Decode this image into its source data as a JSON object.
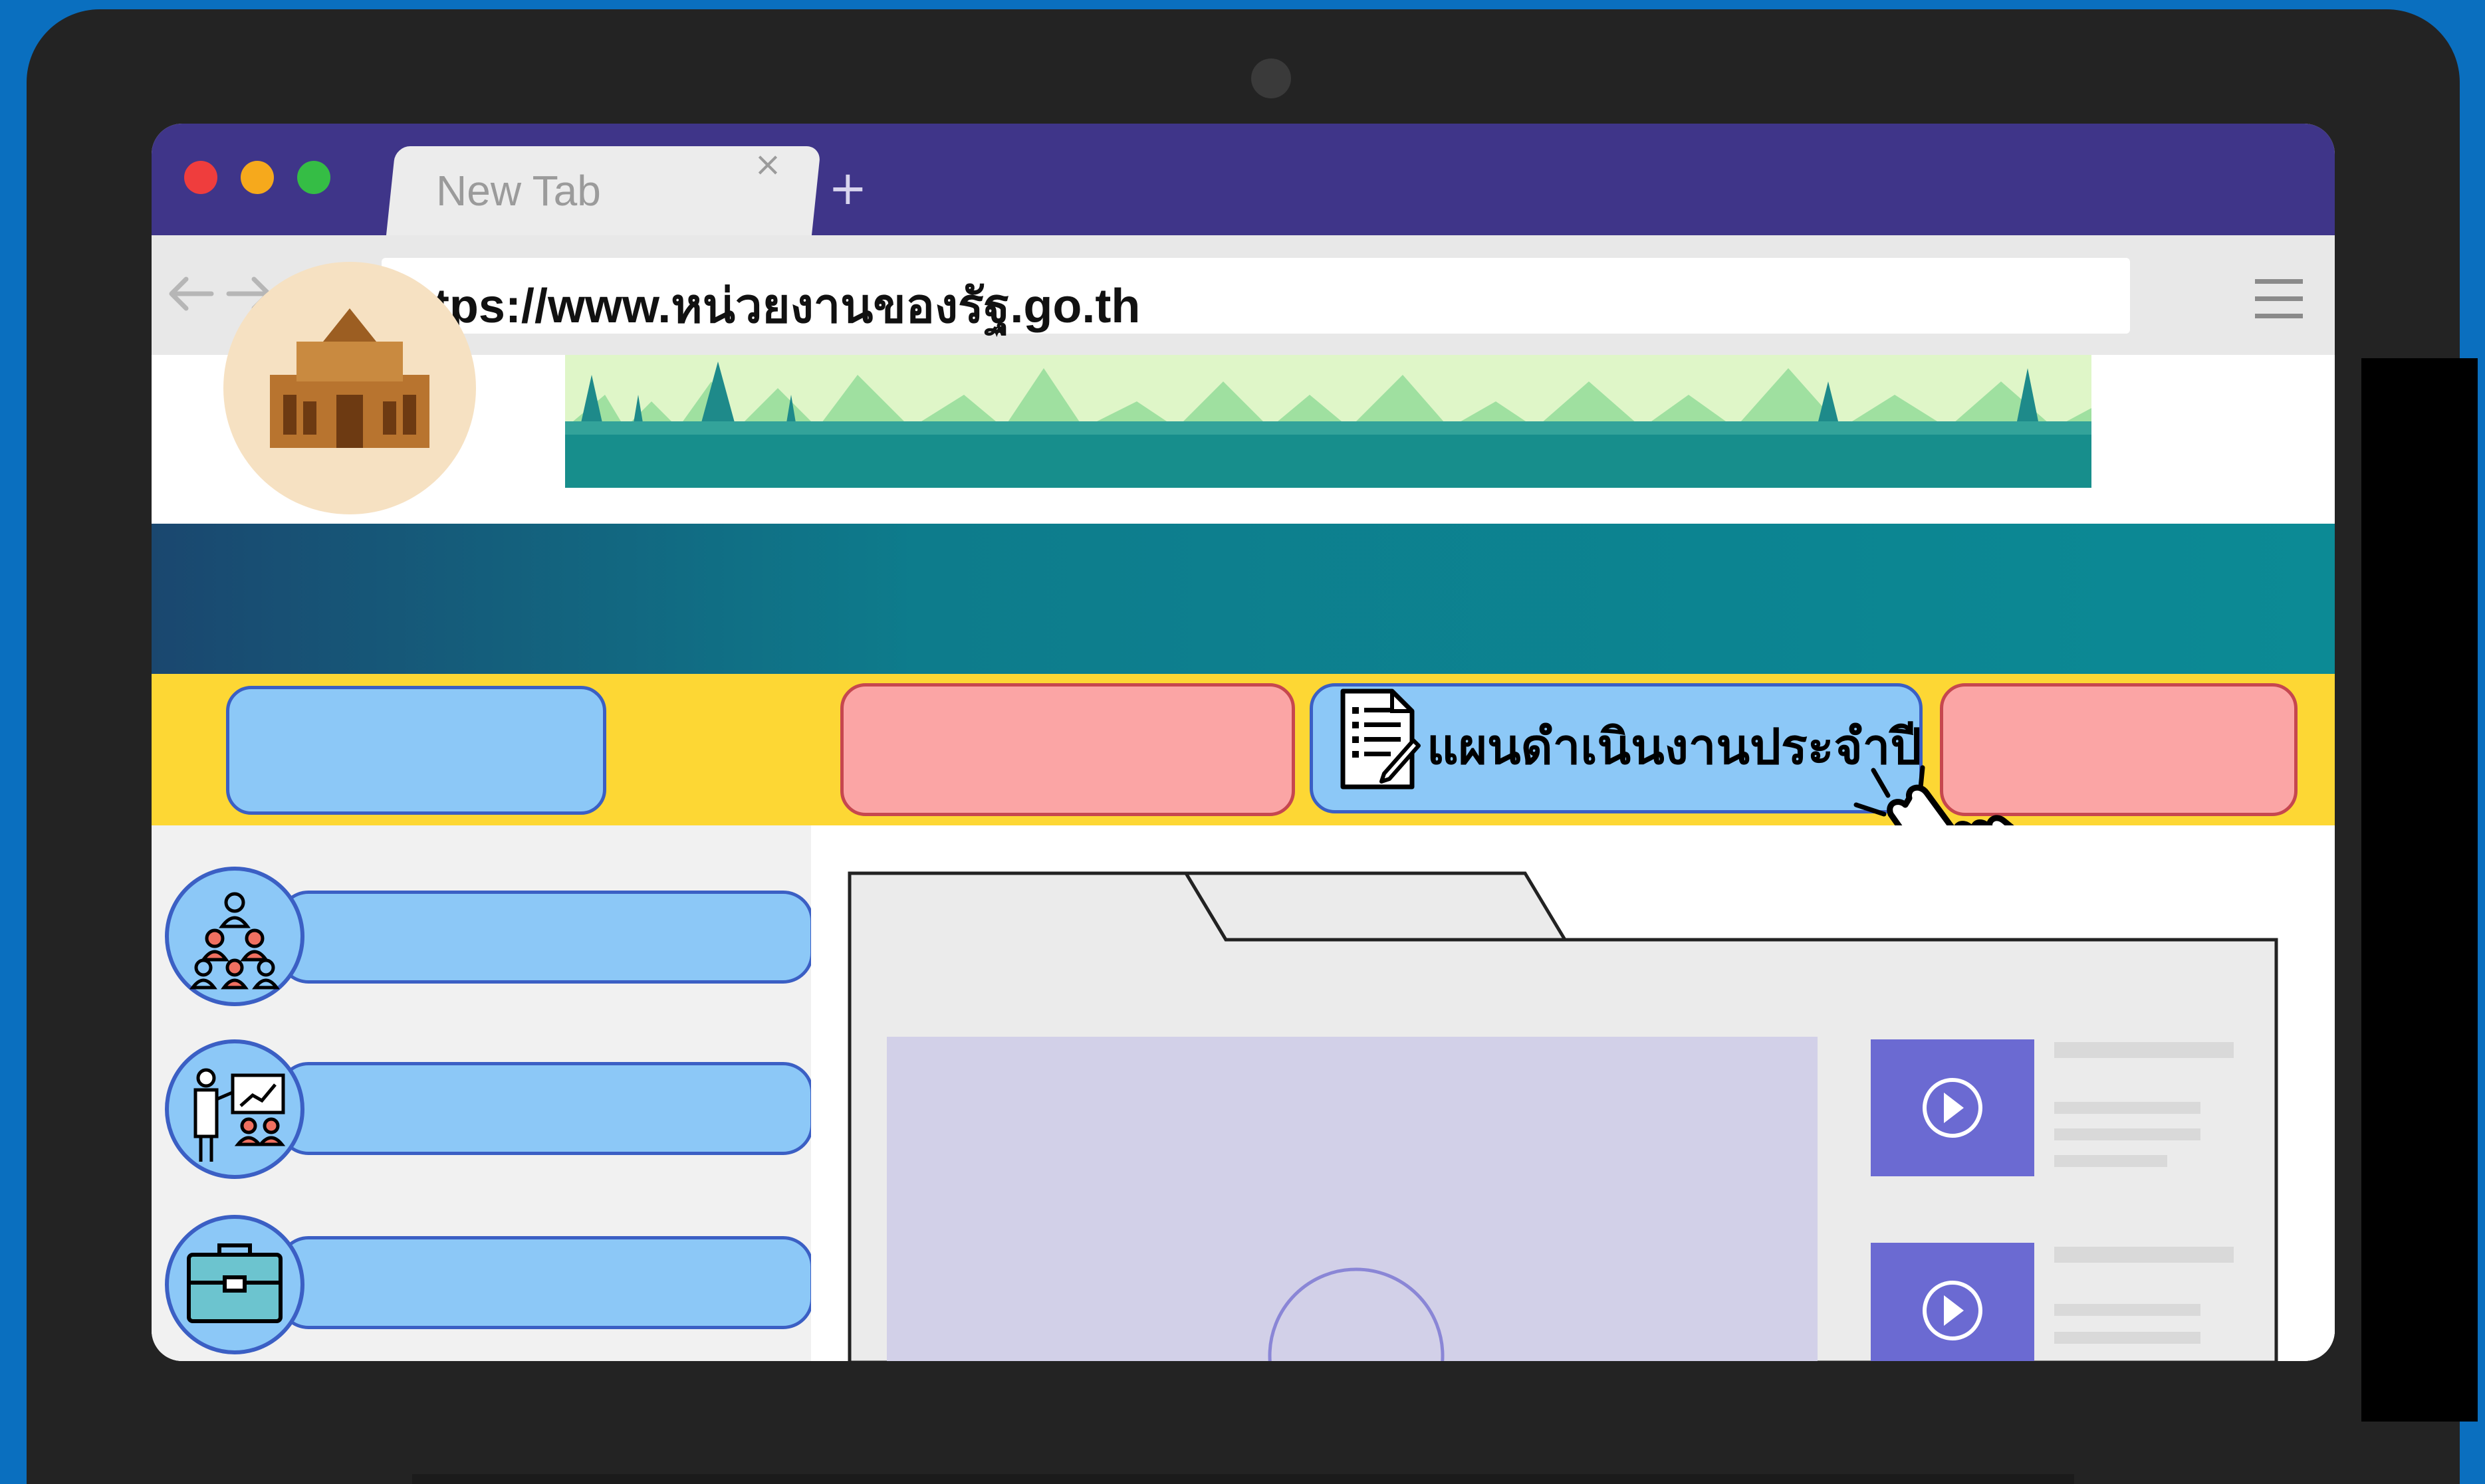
{
  "browser": {
    "tab_title": "New Tab",
    "tab_close": "×",
    "new_tab": "+",
    "url": "https://www.หน่วยงานของรัฐ.go.th"
  },
  "menu_bar": {
    "active_button_label": "แผนดำเนินงานประจำปี"
  },
  "colors": {
    "pill_blue": "#8cc8f7",
    "pill_pink": "#fba5a5",
    "yellow_band": "#fdd734",
    "tab_bar": "#3f3589"
  },
  "icons": {
    "back": "back-arrow-icon",
    "forward": "forward-arrow-icon",
    "reload": "reload-icon",
    "bookmark": "star-icon",
    "menu": "hamburger-menu-icon",
    "document": "document-edit-icon",
    "cursor": "hand-pointer-icon",
    "sidebar": [
      "organization-icon",
      "presentation-icon",
      "briefcase-icon"
    ],
    "play": "play-icon"
  }
}
